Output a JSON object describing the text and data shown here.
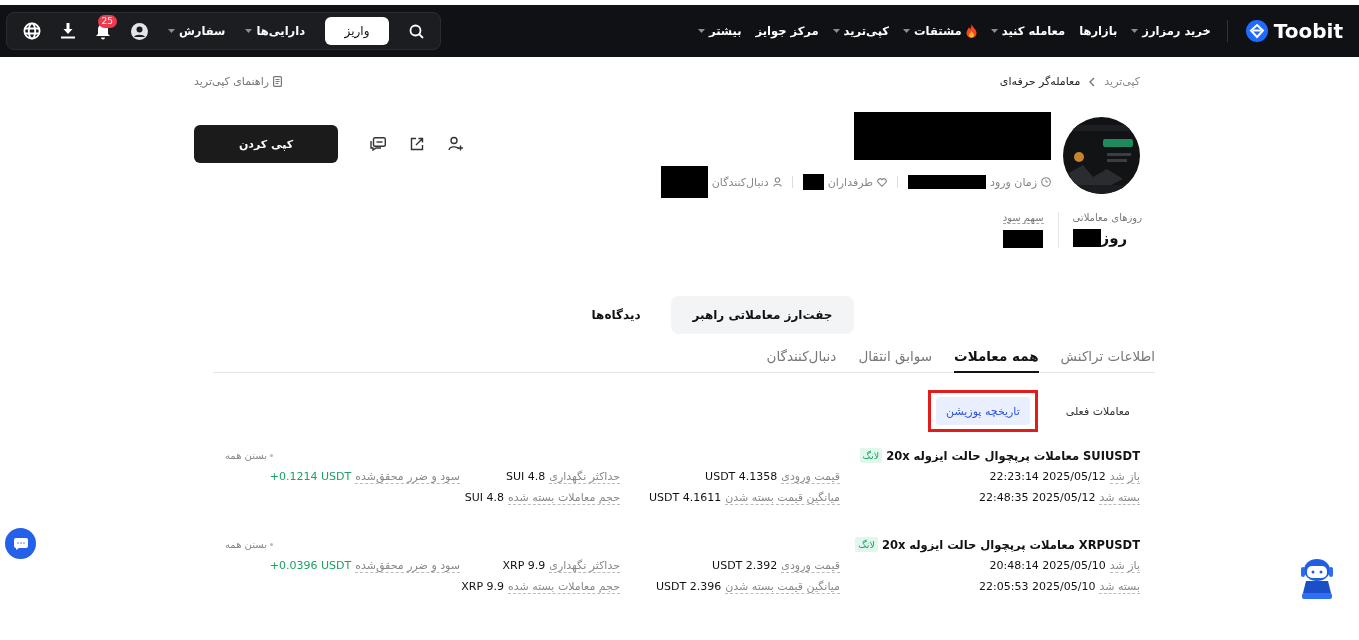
{
  "nav": {
    "logo": "Toobit",
    "items": [
      {
        "label": "خرید رمزارز",
        "dropdown": true,
        "hot": false
      },
      {
        "label": "بازارها",
        "dropdown": false,
        "hot": false
      },
      {
        "label": "معامله کنید",
        "dropdown": true,
        "hot": false
      },
      {
        "label": "مشتقات",
        "dropdown": true,
        "hot": true
      },
      {
        "label": "کپی‌ترید",
        "dropdown": true,
        "hot": false
      },
      {
        "label": "مرکز جوایز",
        "dropdown": false,
        "hot": false
      },
      {
        "label": "بیشتر",
        "dropdown": true,
        "hot": false
      }
    ],
    "deposit": "واریز",
    "account_menus": [
      {
        "label": "دارایی‌ها",
        "dropdown": true
      },
      {
        "label": "سفارش",
        "dropdown": true
      }
    ],
    "notification_count": "25"
  },
  "breadcrumb": [
    {
      "label": "کپی‌ترید"
    },
    {
      "label": "معامله‌گر حرفه‌ای"
    }
  ],
  "guide_link": "راهنمای کپی‌ترید",
  "profile": {
    "meta": [
      {
        "kind": "join",
        "label": "زمان ورود"
      },
      {
        "kind": "fans",
        "label": "طرفداران"
      },
      {
        "kind": "followers",
        "label": "دنبال‌کنندگان"
      }
    ],
    "copy_button": "کپی کردن",
    "stats": [
      {
        "label": "روزهای معاملاتی",
        "value": "روز",
        "underlined": false
      },
      {
        "label": "سهم سود",
        "underlined": true
      }
    ]
  },
  "view_tabs": [
    {
      "label": "جفت‌ارز معاملاتی راهبر",
      "selected": true
    },
    {
      "label": "دیدگاه‌ها",
      "selected": false
    }
  ],
  "sub_tabs": [
    {
      "label": "اطلاعات تراکنش",
      "selected": false
    },
    {
      "label": "همه معاملات",
      "selected": true
    },
    {
      "label": "سوابق انتقال",
      "selected": false
    },
    {
      "label": "دنبال‌کنندگان",
      "selected": false
    }
  ],
  "filters": [
    {
      "label": "معاملات فعلی",
      "selected": false,
      "highlighted": false
    },
    {
      "label": "تاریخچه پوزیشن",
      "selected": true,
      "highlighted": true
    }
  ],
  "trades": [
    {
      "title": "SUIUSDT معاملات پرپچوال حالت ایزوله 20x",
      "side": "لانگ",
      "close_all": "بستن همه",
      "rows": [
        [
          {
            "label": "باز شد",
            "value": "22:23:14 2025/05/12",
            "profit": false
          },
          {
            "label": "قیمت ورودی",
            "value": "USDT 4.1358",
            "profit": false
          },
          {
            "label": "حداکثر نگهداری",
            "value": "SUI 4.8",
            "profit": false
          },
          {
            "label": "سود و ضرر محقق‌شده",
            "value": "+0.1214 USDT",
            "profit": true
          }
        ],
        [
          {
            "label": "بسته شد",
            "value": "22:48:35 2025/05/12",
            "profit": false
          },
          {
            "label": "میانگین قیمت بسته شدن",
            "value": "USDT 4.1611",
            "profit": false
          },
          {
            "label": "حجم معاملات بسته شده",
            "value": "SUI 4.8",
            "profit": false
          }
        ]
      ]
    },
    {
      "title": "XRPUSDT معاملات پرپچوال حالت ایزوله 20x",
      "side": "لانگ",
      "close_all": "بستن همه",
      "rows": [
        [
          {
            "label": "باز شد",
            "value": "20:48:14 2025/05/10",
            "profit": false
          },
          {
            "label": "قیمت ورودی",
            "value": "USDT 2.392",
            "profit": false
          },
          {
            "label": "حداکثر نگهداری",
            "value": "XRP 9.9",
            "profit": false
          },
          {
            "label": "سود و ضرر محقق‌شده",
            "value": "+0.0396 USDT",
            "profit": true
          }
        ],
        [
          {
            "label": "بسته شد",
            "value": "22:05:53 2025/05/10",
            "profit": false
          },
          {
            "label": "میانگین قیمت بسته شدن",
            "value": "USDT 2.396",
            "profit": false
          },
          {
            "label": "حجم معاملات بسته شده",
            "value": "XRP 9.9",
            "profit": false
          }
        ]
      ]
    }
  ]
}
